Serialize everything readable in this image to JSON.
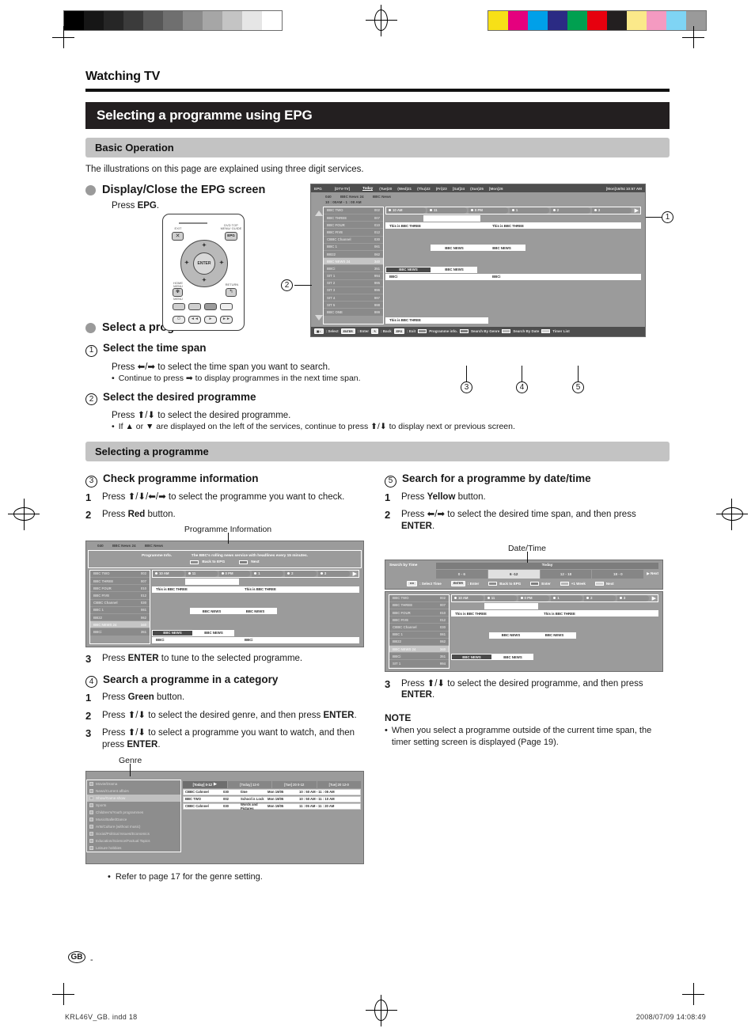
{
  "print_marks": {
    "grayscale_steps": [
      "#000000",
      "#161616",
      "#262626",
      "#3b3b3b",
      "#575757",
      "#6f6f6f",
      "#8b8b8b",
      "#a6a6a6",
      "#c4c4c4",
      "#e6e6e6",
      "#ffffff"
    ],
    "color_steps": [
      "#f7e017",
      "#e5007e",
      "#00a0e9",
      "#2b2b84",
      "#00a050",
      "#e7000e",
      "#231f20",
      "#fbe98a",
      "#f49ac1",
      "#7fd4f4",
      "#9a9a9a"
    ]
  },
  "page": {
    "chapter": "Watching TV",
    "section_title": "Selecting a programme using EPG",
    "subsection_basic": "Basic Operation",
    "intro": "The illustrations on this page are explained using three digit services.",
    "subsection_selecting": "Selecting a programme",
    "country_badge": "GB",
    "page_dash": "-",
    "footer_left": "KRL46V_GB. indd    18",
    "footer_right": "2008/07/09    14:08:49"
  },
  "display_close": {
    "heading": "Display/Close the EPG screen",
    "press": "Press ",
    "press_key": "EPG",
    "press_end": "."
  },
  "remote": {
    "exit_label": "EXIT",
    "epg_label": "EPG",
    "epg_top_label": "DVD TOP MENU/ GUIDE",
    "home_label": "HOME MENU",
    "menu_label": "MENU",
    "return_label": "RETURN",
    "enter_label": "ENTER"
  },
  "select_programme": {
    "heading": "Select a programme",
    "step1": {
      "num": "1",
      "title": "Select the time span",
      "press": "Press ⬅/➡ to select the time span you want to search.",
      "bullet": "Continue to press ➡ to display programmes in the next time span."
    },
    "step2": {
      "num": "2",
      "title": "Select the desired programme",
      "press": "Press ⬆/⬇ to select the desired programme.",
      "bullet": "If ▲ or ▼ are displayed on the left of the services, continue to press ⬆/⬇ to display next or previous screen."
    }
  },
  "epg_screen": {
    "label": "EPG",
    "source": "[DTV-TV]",
    "today": "Today",
    "days": [
      "(Tue)20",
      "(Wed)21",
      "(Thu)22",
      "(Fri)23",
      "[Sat]24",
      "(Sun)25",
      "[Mon]26"
    ],
    "clock": "[Mon]16/04  10:57 AM",
    "info_number": "040",
    "info_channel": "BBC News 24",
    "info_programme": "BBC News",
    "info_time": "10 : 00AM - 1 : 00 AM",
    "time_slots": [
      "10 AM",
      "11",
      "0 PM",
      "1",
      "2",
      "3"
    ],
    "next_arrow": "▶",
    "channels": [
      {
        "name": "BBC TWO",
        "num": "002",
        "highlight": false
      },
      {
        "name": "BBC THREE",
        "num": "007",
        "highlight": false
      },
      {
        "name": "BBC FOUR",
        "num": "010",
        "highlight": false
      },
      {
        "name": "BBC FIVE",
        "num": "012",
        "highlight": false
      },
      {
        "name": "CBBC Channel",
        "num": "030",
        "highlight": false
      },
      {
        "name": "BBC 1",
        "num": "061",
        "highlight": false
      },
      {
        "name": "BB22",
        "num": "062",
        "highlight": false
      },
      {
        "name": "BBC NEWS 24",
        "num": "340",
        "highlight": true
      },
      {
        "name": "BBCi",
        "num": "351",
        "highlight": false
      },
      {
        "name": "SIT 1",
        "num": "994",
        "highlight": false
      },
      {
        "name": "SIT 2",
        "num": "995",
        "highlight": false
      },
      {
        "name": "SIT 3",
        "num": "996",
        "highlight": false
      },
      {
        "name": "SIT 4",
        "num": "997",
        "highlight": false
      },
      {
        "name": "SIT 5",
        "num": "998",
        "highlight": false
      },
      {
        "name": "BBC ONE",
        "num": "999",
        "highlight": false
      }
    ],
    "programmes": {
      "bbc_three_1": "This is BBC THREE",
      "bbc_three_2": "This is BBC THREE",
      "bbc_news_a": "BBC NEWS",
      "bbc_news_b": "BBC NEWS",
      "bbc_news_sel": "BBC NEWS",
      "bbc_news_next": "BBC NEWS",
      "bbci_1": "BBCi",
      "bbci_2": "BBCi",
      "bbc_one": "This is BBC THREE"
    },
    "footer": {
      "select_cap": "⬍⬌",
      "select": ": Select",
      "enter_cap": "ENTER",
      "enter": ": Enter",
      "back": ": Back",
      "exit_cap": "EPG",
      "exit": ": Exit",
      "prog_info": "Programme info.",
      "genre": "Search By Genre",
      "date": "Search By Date",
      "timer": "Timer List"
    }
  },
  "callouts": {
    "c1": "1",
    "c2": "2",
    "c3": "3",
    "c4": "4",
    "c5": "5"
  },
  "check_info": {
    "num": "3",
    "title": "Check programme information",
    "s1_n": "1",
    "s1": "Press ⬆/⬇/⬅/➡ to select the programme you want to check.",
    "s2_n": "2",
    "s2_pre": "Press ",
    "s2_key": "Red",
    "s2_post": " button.",
    "caption": "Programme Information",
    "s3_n": "3",
    "s3_pre": "Press ",
    "s3_key": "ENTER",
    "s3_post": " to tune to the selected programme."
  },
  "prog_info_screen": {
    "header_num": "040",
    "header_chan": "BBC News 24",
    "header_prog": "BBC News",
    "panel_label": "Programme Info.",
    "panel_text": "The BBC's rolling news service with headlines every 15 minutes.",
    "back_to_epg": "Back to EPG",
    "next": "Next"
  },
  "search_category": {
    "num": "4",
    "title": "Search a programme in a category",
    "s1_n": "1",
    "s1_pre": "Press ",
    "s1_key": "Green",
    "s1_post": " button.",
    "s2_n": "2",
    "s2": "Press ⬆/⬇ to select the desired genre, and then press ",
    "s2_key": "ENTER",
    "s2_post": ".",
    "s3_n": "3",
    "s3": "Press ⬆/⬇ to select a programme you want to watch, and then press ",
    "s3_key": "ENTER",
    "s3_post": ".",
    "caption": "Genre",
    "refer": "Refer to page 17 for the genre setting."
  },
  "genre_screen": {
    "genres": [
      {
        "label": "Movie/Drama",
        "sel": false
      },
      {
        "label": "News/Current affairs",
        "sel": false
      },
      {
        "label": "Show/Game show",
        "sel": true
      },
      {
        "label": "Sports",
        "sel": false
      },
      {
        "label": "Children's/Youth programmes",
        "sel": false
      },
      {
        "label": "Music/Ballet/Dance",
        "sel": false
      },
      {
        "label": "Arts/Culture (without music)",
        "sel": false
      },
      {
        "label": "Social/Political Issues/Economics",
        "sel": false
      },
      {
        "label": "Education/Science/Factual Topics",
        "sel": false
      },
      {
        "label": "Leisure hobbies",
        "sel": false
      }
    ],
    "tabs": [
      {
        "label": "[Today] 0-12",
        "sel": true,
        "arrow": "▶"
      },
      {
        "label": "[Today]  12-0",
        "sel": false,
        "arrow": ""
      },
      {
        "label": "[Tue] 20 0-12",
        "sel": false,
        "arrow": ""
      },
      {
        "label": "[Tue] 20 12-0",
        "sel": false,
        "arrow": ""
      }
    ],
    "rows": [
      {
        "chan": "CBBC Cahnnel",
        "num": "030",
        "title": "time",
        "date": "Mon 19/05",
        "time": "10 : 50 AM - 11 : 05 AM"
      },
      {
        "chan": "BBC TWO",
        "num": "002",
        "title": "School is Lock",
        "date": "Mon 19/05",
        "time": "10 : 50 AM - 11 : 10 AM"
      },
      {
        "chan": "CBBC Cahnnel",
        "num": "030",
        "title": "Words and Pictures",
        "date": "Mon 19/05",
        "time": "11 : 05 AM - 11 : 20 AM"
      }
    ]
  },
  "search_datetime": {
    "num": "5",
    "title": "Search for a programme by date/time",
    "s1_n": "1",
    "s1_pre": "Press ",
    "s1_key": "Yellow",
    "s1_post": " button.",
    "s2_n": "2",
    "s2": "Press ⬅/➡ to select the desired time span, and then press ",
    "s2_key": "ENTER",
    "s2_post": ".",
    "caption": "Date/Time",
    "s3_n": "3",
    "s3": "Press ⬆/⬇ to select the desired programme, and then press ",
    "s3_key": "ENTER",
    "s3_post": "."
  },
  "datetime_screen": {
    "label": "Search by Time",
    "today": "Today",
    "slots": [
      {
        "label": "0 - 6",
        "sel": false
      },
      {
        "label": "6 -12",
        "sel": true
      },
      {
        "label": "12 - 18",
        "sel": false
      },
      {
        "label": "18 - 0",
        "sel": false
      }
    ],
    "next": "▶ Next",
    "foot_select": ": Select Time",
    "foot_enter_cap": "ENTER",
    "foot_enter": ": Enter",
    "foot_back": "Back to EPG",
    "foot_enter2": "Enter",
    "foot_week": "+1 Week",
    "foot_next": "Next"
  },
  "note": {
    "title": "NOTE",
    "text": "When you select a programme outside of the current time span, the timer setting screen is displayed (Page 19)."
  }
}
